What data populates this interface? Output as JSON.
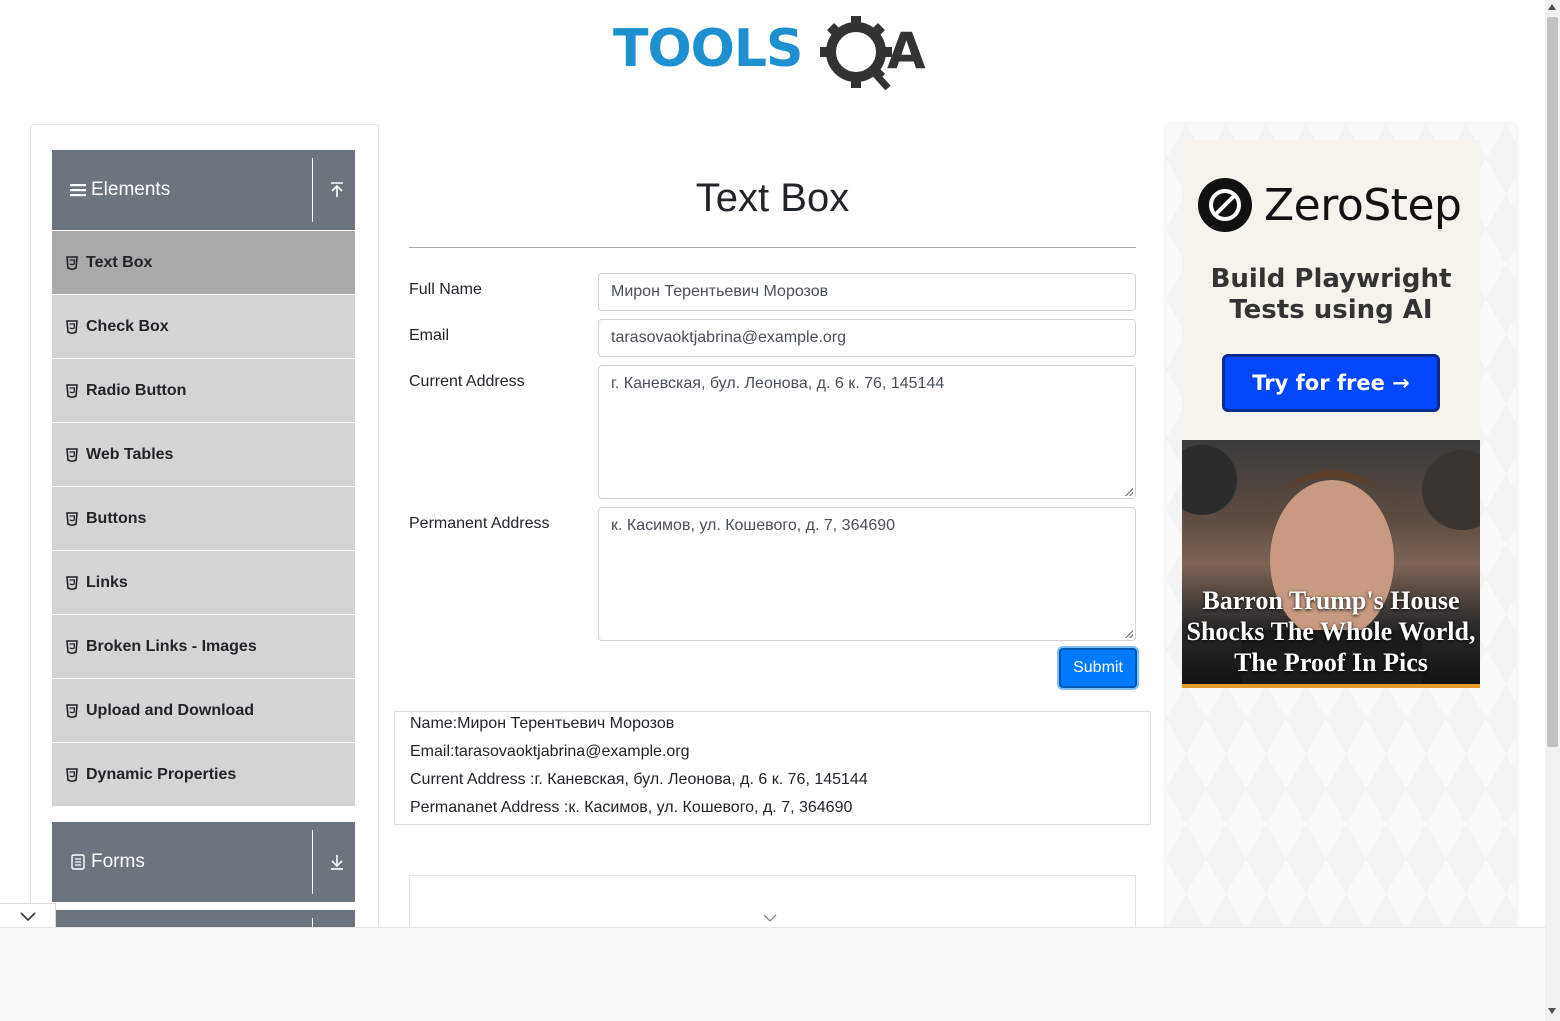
{
  "header": {
    "logo_text": "TOOLSQA",
    "logo_colors": {
      "tools": "#1E8FCF",
      "qa": "#333333"
    }
  },
  "sidebar": {
    "groups": [
      {
        "label": "Elements",
        "icon": "hamburger-icon",
        "expanded": true,
        "items": [
          {
            "label": "Text Box",
            "active": true
          },
          {
            "label": "Check Box"
          },
          {
            "label": "Radio Button"
          },
          {
            "label": "Web Tables"
          },
          {
            "label": "Buttons"
          },
          {
            "label": "Links"
          },
          {
            "label": "Broken Links - Images"
          },
          {
            "label": "Upload and Download"
          },
          {
            "label": "Dynamic Properties"
          }
        ]
      },
      {
        "label": "Forms",
        "icon": "document-icon",
        "expanded": false
      }
    ],
    "colors": {
      "group_header": "#6c757d",
      "item": "#d4d4d4",
      "item_active": "#a9a9a9"
    }
  },
  "main": {
    "title": "Text Box",
    "form": {
      "full_name": {
        "label": "Full Name",
        "value": "Мирон Терентьевич Морозов"
      },
      "email": {
        "label": "Email",
        "value": "tarasovaoktjabrina@example.org"
      },
      "current_address": {
        "label": "Current Address",
        "value": "г. Каневская, бул. Леонова, д. 6 к. 76, 145144"
      },
      "permanent_address": {
        "label": "Permanent Address",
        "value": "к. Касимов, ул. Кошевого, д. 7, 364690"
      },
      "submit_label": "Submit"
    },
    "output": {
      "name": "Name:Мирон Терентьевич Морозов",
      "email": "Email:tarasovaoktjabrina@example.org",
      "current_address": "Current Address :г. Каневская, бул. Леонова, д. 6 к. 76, 145144",
      "permanent_address": "Permananet Address :к. Касимов, ул. Кошевого, д. 7, 364690"
    },
    "accent": "#007bff"
  },
  "ad": {
    "brand": "ZeroStep",
    "tagline_line1": "Build Playwright",
    "tagline_line2": "Tests using AI",
    "cta": "Try for free →",
    "headline": "Barron Trump's House Shocks The Whole World, The Proof In Pics",
    "cta_color": "#0047ff"
  }
}
